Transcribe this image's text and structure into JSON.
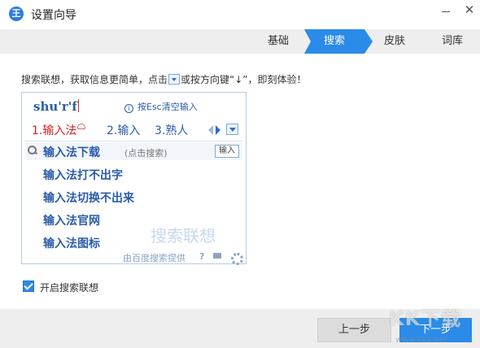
{
  "window": {
    "title": "设置向导",
    "logo_glyph": "王",
    "minimize_icon": "minimize-icon",
    "close_glyph": "✕"
  },
  "steps": [
    {
      "label": "基础",
      "active": false
    },
    {
      "label": "搜索",
      "active": true
    },
    {
      "label": "皮肤",
      "active": false
    },
    {
      "label": "词库",
      "active": false
    }
  ],
  "intro": {
    "before": "搜索联想，获取信息更简单，点击",
    "after": "或按方向键“↓”，即刻体验！"
  },
  "preview": {
    "pinyin": "shu'r'f",
    "hint": "按Esc清空输入",
    "candidates": [
      "1.输入法",
      "2.输入",
      "3.熟人"
    ],
    "search_term": "输入法下载",
    "search_tag": "(点击搜索)",
    "enter_label": "输入",
    "suggestions": [
      "输入法打不出字",
      "输入法切换不出来",
      "输入法官网",
      "输入法图标"
    ],
    "watermark": "搜索联想",
    "provider": "由百度搜索提供",
    "help_glyph": "?"
  },
  "option": {
    "label": "开启搜索联想",
    "checked": true
  },
  "footer": {
    "prev": "上一步",
    "next": "下一步"
  },
  "site_watermark": {
    "brand": "KK下载",
    "url": "www.kkx.net"
  },
  "colors": {
    "accent": "#2b8be8",
    "candidate_highlight": "#d01f1f",
    "text_blue": "#2a5caa"
  }
}
